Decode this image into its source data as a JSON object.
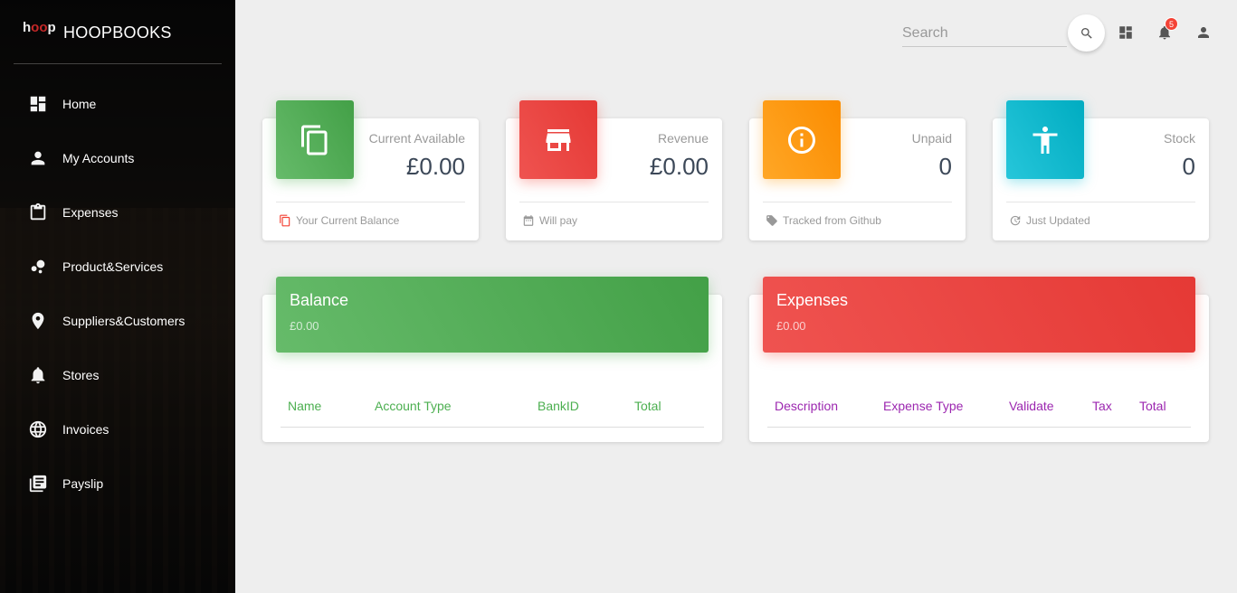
{
  "brand": {
    "logo_prefix": "h",
    "logo_oo": "oo",
    "logo_suffix": "p",
    "title": "HOOPBOOKS"
  },
  "sidebar": {
    "items": [
      {
        "label": "Home",
        "icon": "dashboard-icon"
      },
      {
        "label": "My Accounts",
        "icon": "person-icon"
      },
      {
        "label": "Expenses",
        "icon": "clipboard-icon"
      },
      {
        "label": "Product&Services",
        "icon": "bubbles-icon"
      },
      {
        "label": "Suppliers&Customers",
        "icon": "location-pin-icon"
      },
      {
        "label": "Stores",
        "icon": "bell-icon"
      },
      {
        "label": "Invoices",
        "icon": "globe-icon"
      },
      {
        "label": "Payslip",
        "icon": "library-books-icon"
      }
    ]
  },
  "header": {
    "search_placeholder": "Search",
    "notifications_count": "5"
  },
  "stats": [
    {
      "title": "Current Available",
      "value": "£0.00",
      "footer": "Your Current Balance",
      "icon": "copy-icon",
      "footer_icon": "copy-icon",
      "color": "#4caf50"
    },
    {
      "title": "Revenue",
      "value": "£0.00",
      "footer": "Will pay",
      "icon": "store-icon",
      "footer_icon": "calendar-icon",
      "color": "#f44336"
    },
    {
      "title": "Unpaid",
      "value": "0",
      "footer": "Tracked from Github",
      "icon": "info-icon",
      "footer_icon": "tag-icon",
      "color": "#ff9800"
    },
    {
      "title": "Stock",
      "value": "0",
      "footer": "Just Updated",
      "icon": "accessibility-icon",
      "footer_icon": "update-icon",
      "color": "#00bcd4"
    }
  ],
  "balance": {
    "title": "Balance",
    "amount": "£0.00",
    "columns": [
      "Name",
      "Account Type",
      "BankID",
      "Total"
    ]
  },
  "expenses": {
    "title": "Expenses",
    "amount": "£0.00",
    "columns": [
      "Description",
      "Expense Type",
      "Validate",
      "Tax",
      "Total"
    ]
  }
}
